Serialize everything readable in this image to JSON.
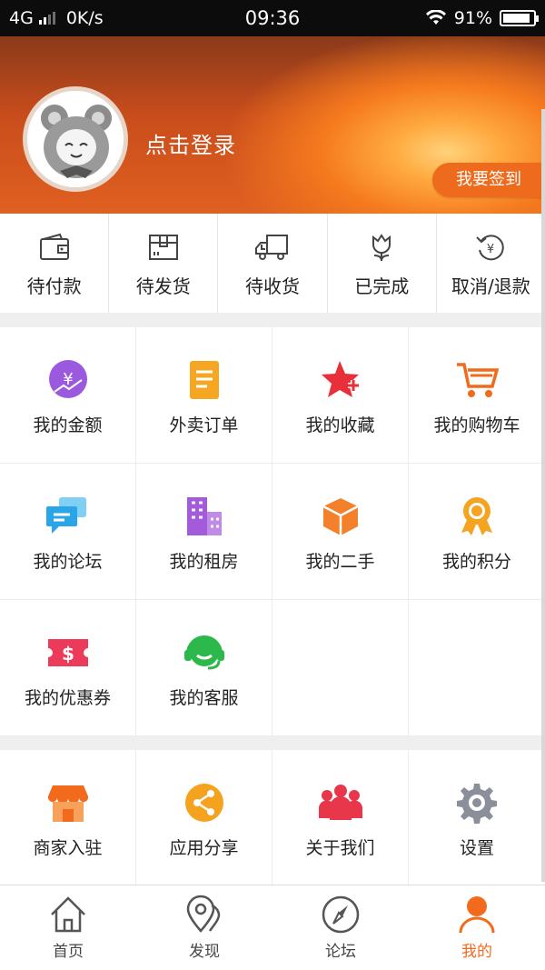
{
  "status_bar": {
    "network": "4G",
    "speed": "0K/s",
    "time": "09:36",
    "battery": "91%",
    "battery_level": 0.91
  },
  "header": {
    "login_text": "点击登录",
    "signin_button": "我要签到"
  },
  "orders": [
    {
      "label": "待付款",
      "icon": "wallet-icon"
    },
    {
      "label": "待发货",
      "icon": "package-icon"
    },
    {
      "label": "待收货",
      "icon": "truck-icon"
    },
    {
      "label": "已完成",
      "icon": "flower-icon"
    },
    {
      "label": "取消/退款",
      "icon": "refund-icon"
    }
  ],
  "grid": [
    {
      "label": "我的金额",
      "icon": "coin-icon",
      "color": "#9b59e0"
    },
    {
      "label": "外卖订单",
      "icon": "document-icon",
      "color": "#f5a623"
    },
    {
      "label": "我的收藏",
      "icon": "star-icon",
      "color": "#e8303a"
    },
    {
      "label": "我的购物车",
      "icon": "cart-icon",
      "color": "#f26b1d"
    },
    {
      "label": "我的论坛",
      "icon": "chat-icon",
      "color": "#2aa6e8"
    },
    {
      "label": "我的租房",
      "icon": "building-icon",
      "color": "#a35bdc"
    },
    {
      "label": "我的二手",
      "icon": "box-icon",
      "color": "#f3802b"
    },
    {
      "label": "我的积分",
      "icon": "medal-icon",
      "color": "#f4a420"
    },
    {
      "label": "我的优惠券",
      "icon": "coupon-icon",
      "color": "#ec3b5a"
    },
    {
      "label": "我的客服",
      "icon": "headset-icon",
      "color": "#2cb84a"
    }
  ],
  "grid2": [
    {
      "label": "商家入驻",
      "icon": "shop-icon",
      "color": "#f26b1d"
    },
    {
      "label": "应用分享",
      "icon": "share-icon",
      "color": "#f5a21f"
    },
    {
      "label": "关于我们",
      "icon": "group-icon",
      "color": "#e8364a"
    },
    {
      "label": "设置",
      "icon": "gear-icon",
      "color": "#8a8f99"
    }
  ],
  "tabbar": [
    {
      "label": "首页",
      "icon": "home-icon",
      "active": false
    },
    {
      "label": "发现",
      "icon": "map-pin-icon",
      "active": false
    },
    {
      "label": "论坛",
      "icon": "compass-icon",
      "active": false
    },
    {
      "label": "我的",
      "icon": "user-icon",
      "active": true
    }
  ],
  "accent_color": "#f26b1d"
}
